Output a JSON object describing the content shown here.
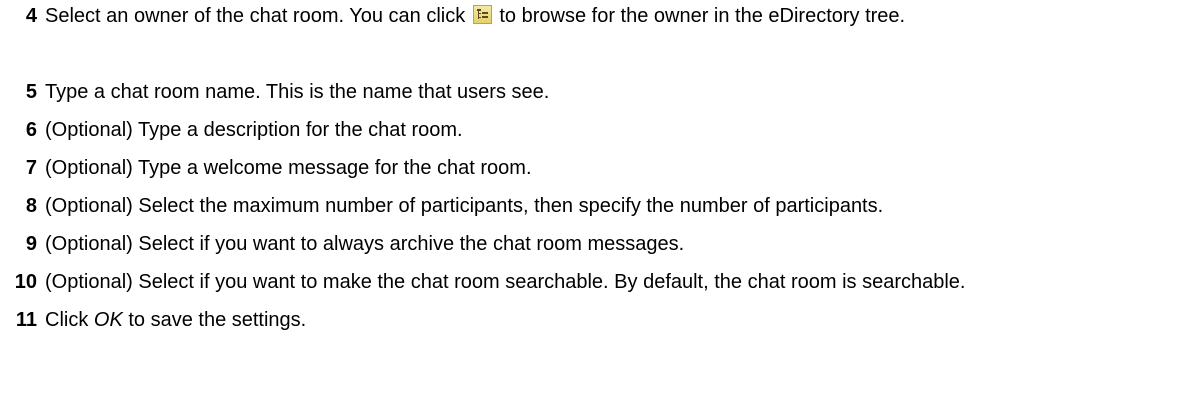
{
  "steps": [
    {
      "number": "4",
      "text_before_icon": "Select an owner of the chat room. You can click ",
      "icon": "browse-tree-icon",
      "text_after_icon": " to browse for the owner in the eDirectory tree."
    },
    {
      "number": "5",
      "text": "Type a chat room name. This is the name that users see."
    },
    {
      "number": "6",
      "text": "(Optional) Type a description for the chat room."
    },
    {
      "number": "7",
      "text": "(Optional) Type a welcome message for the chat room."
    },
    {
      "number": "8",
      "text": "(Optional) Select the maximum number of participants, then specify the number of participants."
    },
    {
      "number": "9",
      "text": "(Optional) Select if you want to always archive the chat room messages."
    },
    {
      "number": "10",
      "text": "(Optional) Select if you want to make the chat room searchable. By default, the chat room is searchable."
    },
    {
      "number": "11",
      "text_before_emphasis": "Click ",
      "emphasis": "OK",
      "text_after_emphasis": " to save the settings."
    }
  ]
}
